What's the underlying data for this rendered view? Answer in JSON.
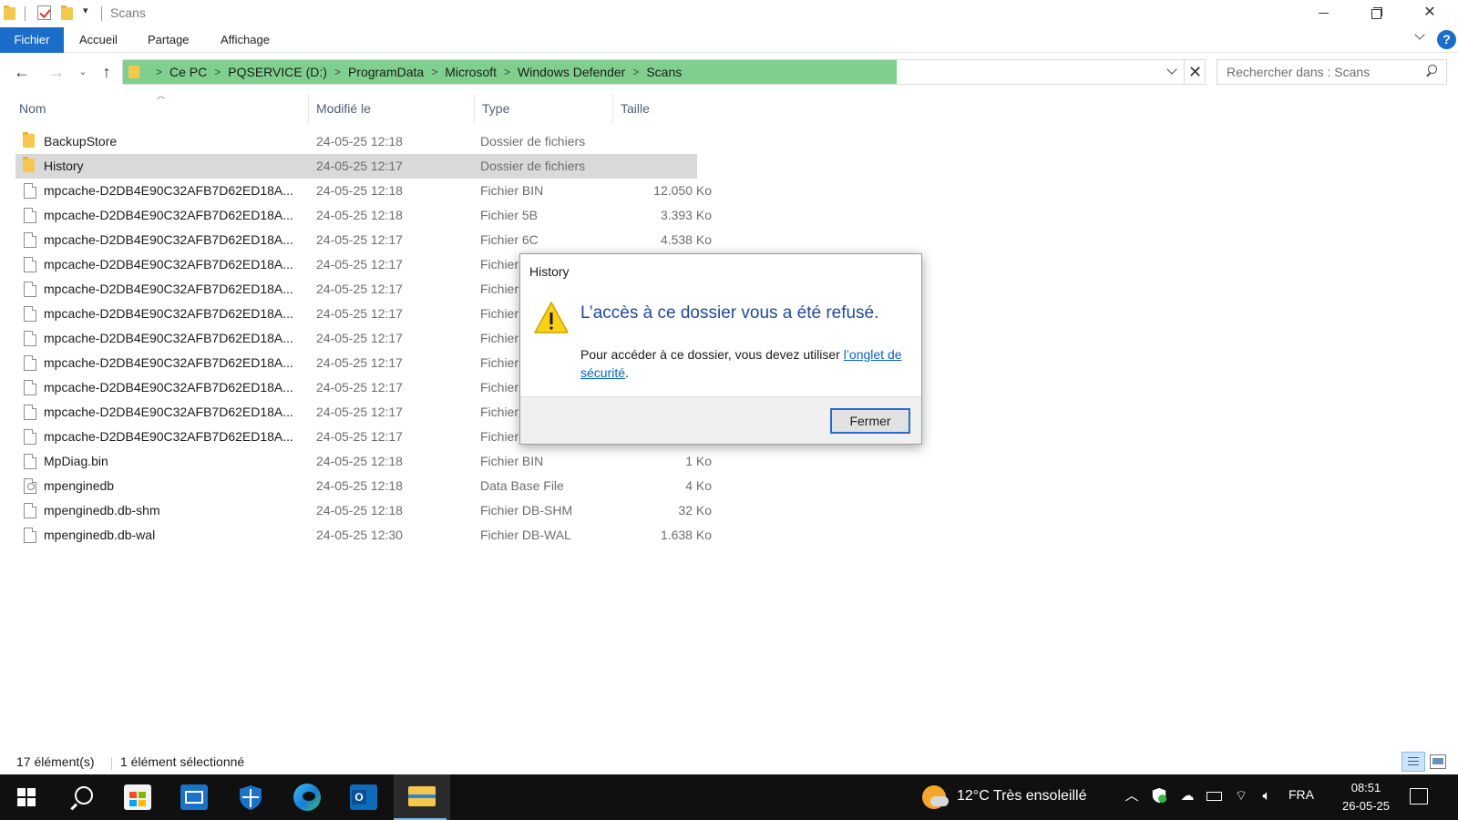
{
  "window": {
    "title": "Scans"
  },
  "ribbon": {
    "tabs": [
      "Fichier",
      "Accueil",
      "Partage",
      "Affichage"
    ]
  },
  "address": {
    "crumbs": [
      "Ce PC",
      "PQSERVICE (D:)",
      "ProgramData",
      "Microsoft",
      "Windows Defender",
      "Scans"
    ],
    "separator": ">"
  },
  "search": {
    "placeholder": "Rechercher dans : Scans"
  },
  "columns": {
    "name": "Nom",
    "modified": "Modifié le",
    "type": "Type",
    "size": "Taille"
  },
  "files": [
    {
      "name": "BackupStore",
      "modified": "24-05-25 12:18",
      "type": "Dossier de fichiers",
      "size": "",
      "icon": "folder-icon",
      "selected": false
    },
    {
      "name": "History",
      "modified": "24-05-25 12:17",
      "type": "Dossier de fichiers",
      "size": "",
      "icon": "folder-icon",
      "selected": true
    },
    {
      "name": "mpcache-D2DB4E90C32AFB7D62ED18A...",
      "modified": "24-05-25 12:18",
      "type": "Fichier BIN",
      "size": "12.050 Ko",
      "icon": "file-icon",
      "selected": false
    },
    {
      "name": "mpcache-D2DB4E90C32AFB7D62ED18A...",
      "modified": "24-05-25 12:18",
      "type": "Fichier 5B",
      "size": "3.393 Ko",
      "icon": "file-icon",
      "selected": false
    },
    {
      "name": "mpcache-D2DB4E90C32AFB7D62ED18A...",
      "modified": "24-05-25 12:17",
      "type": "Fichier 6C",
      "size": "4.538 Ko",
      "icon": "file-icon",
      "selected": false
    },
    {
      "name": "mpcache-D2DB4E90C32AFB7D62ED18A...",
      "modified": "24-05-25 12:17",
      "type": "Fichier",
      "size": "",
      "icon": "file-icon",
      "selected": false
    },
    {
      "name": "mpcache-D2DB4E90C32AFB7D62ED18A...",
      "modified": "24-05-25 12:17",
      "type": "Fichier",
      "size": "",
      "icon": "file-icon",
      "selected": false
    },
    {
      "name": "mpcache-D2DB4E90C32AFB7D62ED18A...",
      "modified": "24-05-25 12:17",
      "type": "Fichier",
      "size": "",
      "icon": "file-icon",
      "selected": false
    },
    {
      "name": "mpcache-D2DB4E90C32AFB7D62ED18A...",
      "modified": "24-05-25 12:17",
      "type": "Fichier",
      "size": "",
      "icon": "file-icon",
      "selected": false
    },
    {
      "name": "mpcache-D2DB4E90C32AFB7D62ED18A...",
      "modified": "24-05-25 12:17",
      "type": "Fichier",
      "size": "",
      "icon": "file-icon",
      "selected": false
    },
    {
      "name": "mpcache-D2DB4E90C32AFB7D62ED18A...",
      "modified": "24-05-25 12:17",
      "type": "Fichier",
      "size": "",
      "icon": "file-icon",
      "selected": false
    },
    {
      "name": "mpcache-D2DB4E90C32AFB7D62ED18A...",
      "modified": "24-05-25 12:17",
      "type": "Fichier",
      "size": "",
      "icon": "file-icon",
      "selected": false
    },
    {
      "name": "mpcache-D2DB4E90C32AFB7D62ED18A...",
      "modified": "24-05-25 12:17",
      "type": "Fichier",
      "size": "",
      "icon": "file-icon",
      "selected": false
    },
    {
      "name": "MpDiag.bin",
      "modified": "24-05-25 12:18",
      "type": "Fichier BIN",
      "size": "1 Ko",
      "icon": "file-icon",
      "selected": false
    },
    {
      "name": "mpenginedb",
      "modified": "24-05-25 12:18",
      "type": "Data Base File",
      "size": "4 Ko",
      "icon": "database-file-icon",
      "selected": false
    },
    {
      "name": "mpenginedb.db-shm",
      "modified": "24-05-25 12:18",
      "type": "Fichier DB-SHM",
      "size": "32 Ko",
      "icon": "file-icon",
      "selected": false
    },
    {
      "name": "mpenginedb.db-wal",
      "modified": "24-05-25 12:30",
      "type": "Fichier DB-WAL",
      "size": "1.638 Ko",
      "icon": "file-icon",
      "selected": false
    }
  ],
  "status": {
    "count": "17 élément(s)",
    "selection": "1 élément sélectionné"
  },
  "dialog": {
    "title": "History",
    "heading": "L’accès à ce dossier vous a été refusé.",
    "body_prefix": "Pour accéder à ce dossier, vous devez utiliser ",
    "body_link": "l’onglet de sécurité",
    "body_suffix": ".",
    "button": "Fermer"
  },
  "taskbar": {
    "weather": "12°C  Très ensoleillé",
    "language": "FRA",
    "time": "08:51",
    "date": "26-05-25"
  },
  "colors": {
    "accent": "#1a6dc8",
    "address_highlight": "#7fd08e",
    "selection": "#d9d9d9",
    "dialog_heading": "#1f4a9c",
    "link": "#0563c1",
    "taskbar": "#101010"
  }
}
